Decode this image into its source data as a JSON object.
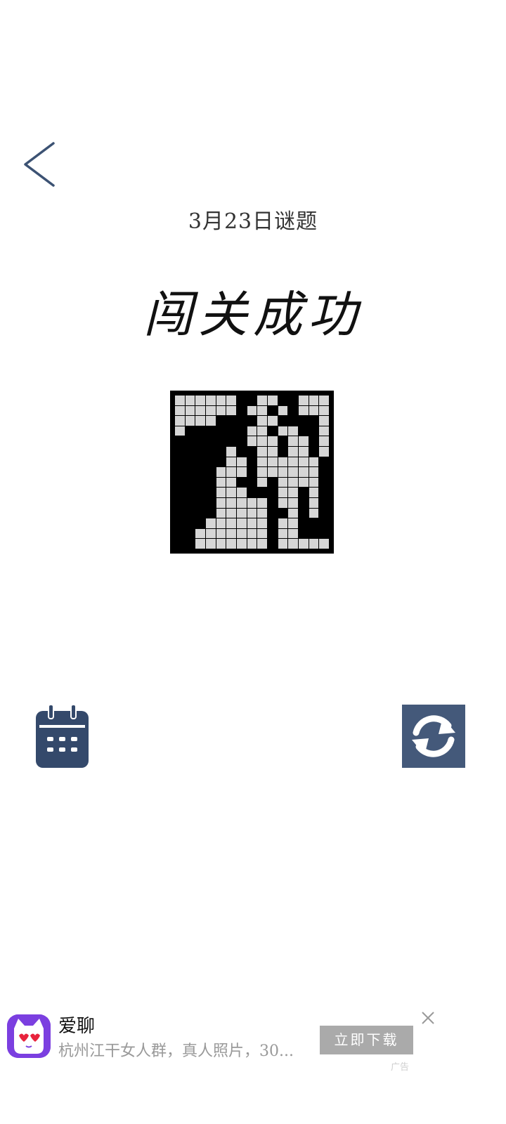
{
  "header": {
    "date_label": "3月23日谜题",
    "result_title": "闯关成功"
  },
  "puzzle": {
    "rows": 15,
    "cols": 15,
    "pattern": [
      "......##..##...",
      "......#..#.#...",
      "....####..####.",
      ".######..#..##.",
      "#######...#..#.",
      "#####.##..#..#.",
      "#####..#......#",
      "####...#......#",
      "####..##.#....#",
      "####...###..#.#",
      "####.....#..#.#",
      "####.....##.#.#",
      "###......#..###",
      "##.......#..###",
      "##.......#....."
    ]
  },
  "icons": {
    "back": "chevron-left-icon",
    "calendar": "calendar-icon",
    "refresh": "refresh-icon",
    "close": "close-icon"
  },
  "ad": {
    "app_name": "爱聊",
    "description": "杭州江干女人群，真人照片，30...",
    "cta_label": "立即下载",
    "ad_label": "广告"
  },
  "colors": {
    "accent": "#44597a",
    "cta": "#aaaaaa",
    "ad_icon": "#7b3fe0"
  }
}
